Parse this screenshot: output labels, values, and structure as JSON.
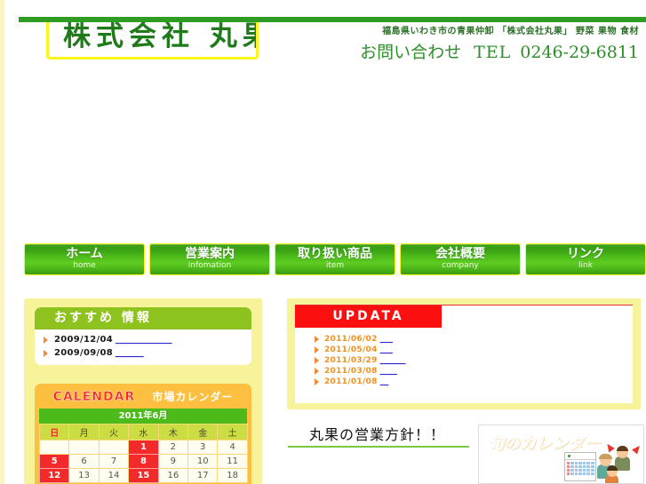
{
  "header": {
    "logo_text": "株式会社 丸果",
    "tagline": "福島県いわき市の青果仲卸 「株式会社丸果」 野菜 果物 食材",
    "contact_label": "お問い合わせ",
    "tel_word": "TEL",
    "tel_number": "0246-29-6811"
  },
  "nav": {
    "items": [
      {
        "ja": "ホーム",
        "en": "home"
      },
      {
        "ja": "営業案内",
        "en": "infomation"
      },
      {
        "ja": "取り扱い商品",
        "en": "item"
      },
      {
        "ja": "会社概要",
        "en": "company"
      },
      {
        "ja": "リンク",
        "en": "link"
      }
    ]
  },
  "osusume": {
    "title": "おすすめ 情報",
    "items": [
      {
        "date": "2009/12/04",
        "link": "____________"
      },
      {
        "date": "2009/09/08",
        "link": "______"
      }
    ]
  },
  "calendar": {
    "title_en": "CALENDAR",
    "title_ja": "市場カレンダー",
    "month": "2011年6月",
    "weekdays": [
      "日",
      "月",
      "火",
      "水",
      "木",
      "金",
      "土"
    ],
    "weeks": [
      [
        "",
        "",
        "",
        "1",
        "2",
        "3",
        "4"
      ],
      [
        "5",
        "6",
        "7",
        "8",
        "9",
        "10",
        "11"
      ],
      [
        "12",
        "13",
        "14",
        "15",
        "16",
        "17",
        "18"
      ]
    ],
    "closed_days": [
      "1",
      "5",
      "8",
      "12",
      "15"
    ]
  },
  "updata": {
    "banner": "UPDATA",
    "items": [
      {
        "date": "2011/06/02",
        "link": "___"
      },
      {
        "date": "2011/05/04",
        "link": "___"
      },
      {
        "date": "2011/03/29",
        "link": "______"
      },
      {
        "date": "2011/03/08",
        "link": "____"
      },
      {
        "date": "2011/01/08",
        "link": "__"
      }
    ]
  },
  "policy": {
    "title": "丸果の営業方針！！"
  },
  "shun": {
    "title": "旬のカレンダー"
  },
  "colors": {
    "green_rule": "#2f9c24",
    "nav_green": "#4cbb1a",
    "panel_yellow": "#f6f39a",
    "banner_red": "#fb0f0f",
    "calendar_orange": "#fcbf3f",
    "accent_orange": "#f7941e",
    "link_blue": "#2a2ad0"
  }
}
